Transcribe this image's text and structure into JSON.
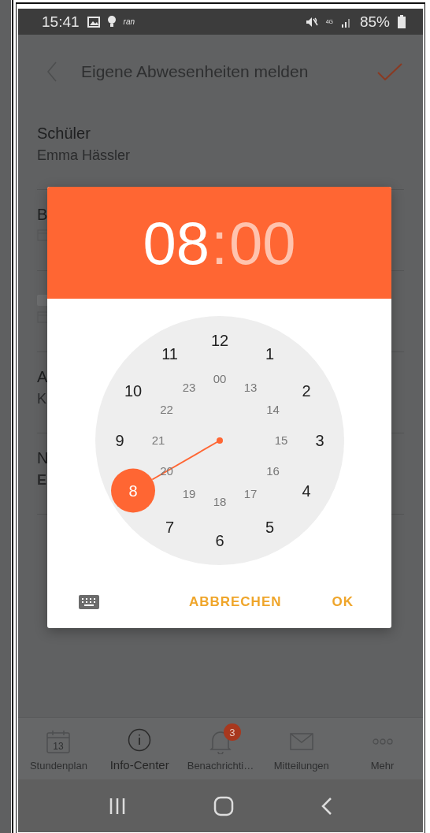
{
  "status_bar": {
    "time": "15:41",
    "notification_text": "ran",
    "network": "4G",
    "battery": "85%"
  },
  "app_bar": {
    "title": "Eigene Abwesenheiten melden"
  },
  "form_rows": [
    {
      "kind": "text",
      "label": "Schüler",
      "value": "Emma Hässler"
    },
    {
      "kind": "date",
      "label": "B"
    },
    {
      "kind": "date_blank"
    },
    {
      "kind": "text",
      "label": "A",
      "value": "K"
    },
    {
      "kind": "bold_value",
      "label": "N",
      "value": "E"
    }
  ],
  "time_picker": {
    "hour": "08",
    "separator": ":",
    "minute": "00",
    "hour_selected": true,
    "outer_ring": [
      {
        "label": "12",
        "selected": false
      },
      {
        "label": "1",
        "selected": false
      },
      {
        "label": "2",
        "selected": false
      },
      {
        "label": "3",
        "selected": false
      },
      {
        "label": "4",
        "selected": false
      },
      {
        "label": "5",
        "selected": false
      },
      {
        "label": "6",
        "selected": false
      },
      {
        "label": "7",
        "selected": false
      },
      {
        "label": "8",
        "selected": true
      },
      {
        "label": "9",
        "selected": false
      },
      {
        "label": "10",
        "selected": false
      },
      {
        "label": "11",
        "selected": false
      }
    ],
    "inner_ring": [
      {
        "label": "00",
        "selected": false
      },
      {
        "label": "13",
        "selected": false
      },
      {
        "label": "14",
        "selected": false
      },
      {
        "label": "15",
        "selected": false
      },
      {
        "label": "16",
        "selected": false
      },
      {
        "label": "17",
        "selected": false
      },
      {
        "label": "18",
        "selected": false
      },
      {
        "label": "19",
        "selected": false
      },
      {
        "label": "20",
        "selected": false
      },
      {
        "label": "21",
        "selected": false
      },
      {
        "label": "22",
        "selected": false
      },
      {
        "label": "23",
        "selected": false
      }
    ],
    "buttons": {
      "cancel": "ABBRECHEN",
      "ok": "OK"
    }
  },
  "bottom_nav": [
    {
      "kind": "calendar",
      "label": "Stundenplan",
      "icon_text": "13",
      "selected": false
    },
    {
      "kind": "info",
      "label": "Info-Center",
      "selected": true
    },
    {
      "kind": "bell",
      "label": "Benachrichti…",
      "badge": "3",
      "selected": false
    },
    {
      "kind": "mail",
      "label": "Mitteilungen",
      "selected": false
    },
    {
      "kind": "more",
      "label": "Mehr",
      "selected": false
    }
  ]
}
